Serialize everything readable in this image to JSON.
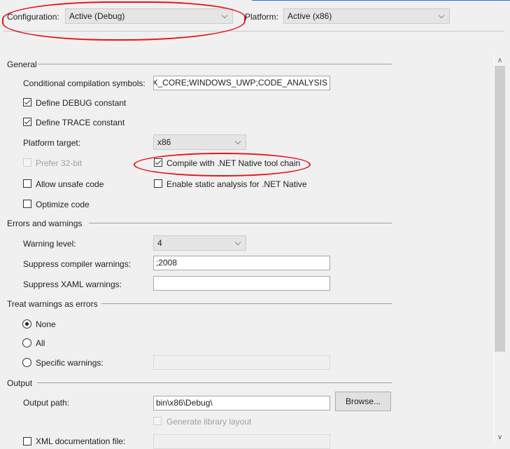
{
  "toolbar": {
    "configuration_label": "Configuration:",
    "configuration_value": "Active (Debug)",
    "platform_label": "Platform:",
    "platform_value": "Active (x86)"
  },
  "general": {
    "title": "General",
    "conditional_symbols_label": "Conditional compilation symbols:",
    "conditional_symbols_value": "NETFX_CORE;WINDOWS_UWP;CODE_ANALYSIS",
    "define_debug": {
      "label": "Define DEBUG constant",
      "checked": true
    },
    "define_trace": {
      "label": "Define TRACE constant",
      "checked": true
    },
    "platform_target_label": "Platform target:",
    "platform_target_value": "x86",
    "prefer_32bit": {
      "label": "Prefer 32-bit",
      "checked": false,
      "enabled": false
    },
    "compile_native": {
      "label": "Compile with .NET Native tool chain",
      "checked": true
    },
    "allow_unsafe": {
      "label": "Allow unsafe code",
      "checked": false
    },
    "static_analysis": {
      "label": "Enable static analysis for .NET Native",
      "checked": false
    },
    "optimize_code": {
      "label": "Optimize code",
      "checked": false
    }
  },
  "errors_warnings": {
    "title": "Errors and warnings",
    "warning_level_label": "Warning level:",
    "warning_level_value": "4",
    "suppress_compiler_label": "Suppress compiler warnings:",
    "suppress_compiler_value": ";2008",
    "suppress_xaml_label": "Suppress XAML warnings:",
    "suppress_xaml_value": ""
  },
  "treat_warnings": {
    "title": "Treat warnings as errors",
    "options": [
      {
        "label": "None",
        "selected": true
      },
      {
        "label": "All",
        "selected": false
      },
      {
        "label": "Specific warnings:",
        "selected": false
      }
    ],
    "specific_value": ""
  },
  "output": {
    "title": "Output",
    "output_path_label": "Output path:",
    "output_path_value": "bin\\x86\\Debug\\",
    "browse_label": "Browse...",
    "generate_library_layout": {
      "label": "Generate library layout",
      "checked": false,
      "enabled": false
    },
    "xml_doc": {
      "label": "XML documentation file:",
      "checked": false
    },
    "xml_doc_value": ""
  },
  "scrollbar": {
    "up_icon": "chevron-up",
    "down_icon": "chevron-down"
  },
  "colors": {
    "accent": "#1f7ad1",
    "annotation": "#e4141b"
  }
}
